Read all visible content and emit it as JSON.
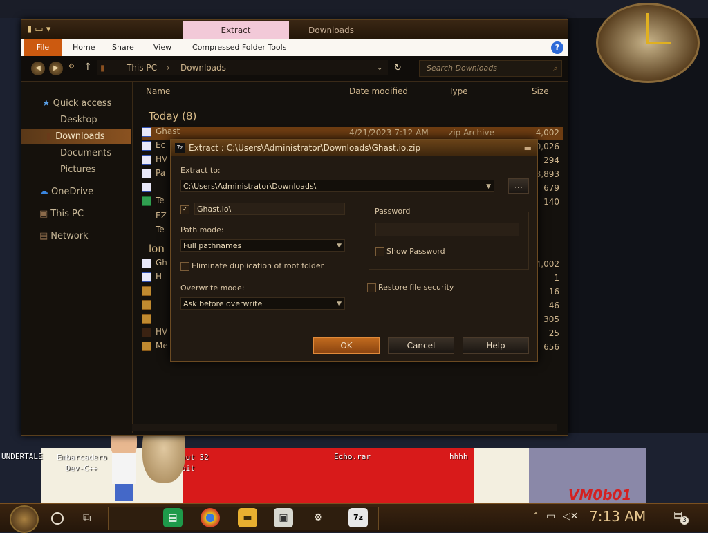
{
  "desktop": {
    "icons": [
      {
        "label": "UNDERTALE"
      },
      {
        "label": "Embarcadero Dev-C++"
      },
      {
        "label": "but 32 bit"
      },
      {
        "label": "Echo.rar"
      },
      {
        "label": "hhhh"
      }
    ],
    "wallpaper_text": "VM0b01"
  },
  "explorer": {
    "tabs": [
      "Extract",
      "Downloads"
    ],
    "ribbon": {
      "file": "File",
      "home": "Home",
      "share": "Share",
      "view": "View",
      "compressed": "Compressed Folder Tools"
    },
    "breadcrumb": [
      "This PC",
      "Downloads"
    ],
    "search_placeholder": "Search Downloads",
    "nav": [
      {
        "label": "Quick access"
      },
      {
        "label": "Desktop"
      },
      {
        "label": "Downloads"
      },
      {
        "label": "Documents"
      },
      {
        "label": "Pictures"
      },
      {
        "label": "OneDrive"
      },
      {
        "label": "This PC"
      },
      {
        "label": "Network"
      }
    ],
    "columns": [
      "Name",
      "Date modified",
      "Type",
      "Size"
    ],
    "groups": [
      {
        "title": "Today (8)"
      },
      {
        "title": "lon"
      }
    ],
    "rows": [
      {
        "name": "Ghast",
        "date": "4/21/2023 7:12 AM",
        "type": "zip Archive",
        "size": "4,002"
      },
      {
        "name": "Ec",
        "date": "",
        "type": "",
        "size": "10,026"
      },
      {
        "name": "HV",
        "date": "",
        "type": "",
        "size": "294"
      },
      {
        "name": "Pa",
        "date": "",
        "type": "",
        "size": "8,893"
      },
      {
        "name": "",
        "date": "",
        "type": "",
        "size": "679"
      },
      {
        "name": "Te",
        "date": "",
        "type": "",
        "size": "140"
      },
      {
        "name": "EZ",
        "date": "",
        "type": "",
        "size": ""
      },
      {
        "name": "Te",
        "date": "",
        "type": "",
        "size": ""
      },
      {
        "name": "Gh",
        "date": "",
        "type": "",
        "size": "4,002"
      },
      {
        "name": "H",
        "date": "",
        "type": "",
        "size": "1"
      },
      {
        "name": "",
        "date": "",
        "type": "",
        "size": "16"
      },
      {
        "name": "",
        "date": "",
        "type": "",
        "size": "46"
      },
      {
        "name": "",
        "date": "",
        "type": "",
        "size": "305"
      },
      {
        "name": "HV",
        "date": "",
        "type": "",
        "size": "25"
      },
      {
        "name": "Me",
        "date": "",
        "type": "",
        "size": "656"
      }
    ]
  },
  "dialog": {
    "title": "Extract : C:\\Users\\Administrator\\Downloads\\Ghast.io.zip",
    "extract_to_label": "Extract to:",
    "extract_to_value": "C:\\Users\\Administrator\\Downloads\\",
    "browse_label": "...",
    "subfolder_value": "Ghast.io\\",
    "path_mode_label": "Path mode:",
    "path_mode_value": "Full pathnames",
    "eliminate_label": "Eliminate duplication of root folder",
    "overwrite_label": "Overwrite mode:",
    "overwrite_value": "Ask before overwrite",
    "password_label": "Password",
    "show_password_label": "Show Password",
    "restore_security_label": "Restore file security",
    "ok": "OK",
    "cancel": "Cancel",
    "help": "Help"
  },
  "taskbar": {
    "time": "7:13 AM",
    "notification_count": "3"
  }
}
